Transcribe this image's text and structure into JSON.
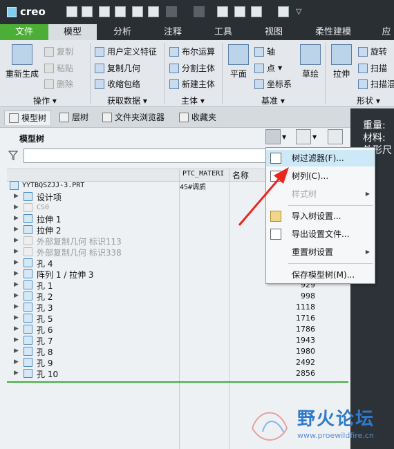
{
  "app": {
    "logo_text": "creo"
  },
  "quick_access": [
    "new-icon",
    "open-icon",
    "save-icon",
    "regenerate-icon",
    "print-icon",
    "copy-icon",
    "undo-icon",
    "redo-icon",
    "regen-icon",
    "sketch-icon",
    "windows-icon",
    "close-icon",
    "more-icon"
  ],
  "ribbon_tabs": [
    {
      "label": "文件"
    },
    {
      "label": "模型"
    },
    {
      "label": "分析"
    },
    {
      "label": "注释"
    },
    {
      "label": "工具"
    },
    {
      "label": "视图"
    },
    {
      "label": "柔性建模"
    },
    {
      "label": "应"
    }
  ],
  "ribbon": {
    "regen": "重新生成",
    "copy": "复制",
    "paste": "粘贴",
    "delete": "删除",
    "udf": "用户定义特征",
    "copy_geom": "复制几何",
    "shrinkwrap": "收缩包络",
    "boolean": "布尔运算",
    "split_body": "分割主体",
    "new_body": "新建主体",
    "plane": "平面",
    "axis": "轴",
    "point": "点",
    "csys": "坐标系",
    "sketch": "草绘",
    "extrude": "拉伸",
    "revolve": "旋转",
    "sweep": "扫描",
    "swept_blend": "扫描混",
    "groups": {
      "operations": "操作",
      "get_data": "获取数据",
      "body": "主体",
      "datum": "基准",
      "shapes": "形状"
    }
  },
  "nav_tabs": [
    {
      "label": "模型树"
    },
    {
      "label": "层树"
    },
    {
      "label": "文件夹浏览器"
    },
    {
      "label": "收藏夹"
    }
  ],
  "tree": {
    "title": "模型树",
    "filter_placeholder": "",
    "columns": [
      "PTC_MATERI",
      "名称"
    ],
    "rows": [
      {
        "label": "YYTBQSZJJ-3.PRT",
        "value": "45#调质",
        "num": ""
      },
      {
        "label": "设计项",
        "value": "",
        "num": ""
      },
      {
        "label": "CS0",
        "value": "",
        "num": ""
      },
      {
        "label": "拉伸 1",
        "value": "",
        "num": ""
      },
      {
        "label": "拉伸 2",
        "value": "",
        "num": ""
      },
      {
        "label": "外部复制几何 标识113",
        "value": "",
        "num": ""
      },
      {
        "label": "外部复制几何 标识338",
        "value": "",
        "num": ""
      },
      {
        "label": "孔 4",
        "value": "",
        "num": ""
      },
      {
        "label": "阵列 1 / 拉伸 3",
        "value": "",
        "num": ""
      },
      {
        "label": "孔 1",
        "value": "",
        "num": "929"
      },
      {
        "label": "孔 2",
        "value": "",
        "num": "998"
      },
      {
        "label": "孔 3",
        "value": "",
        "num": "1118"
      },
      {
        "label": "孔 5",
        "value": "",
        "num": "1716"
      },
      {
        "label": "孔 6",
        "value": "",
        "num": "1786"
      },
      {
        "label": "孔 7",
        "value": "",
        "num": "1943"
      },
      {
        "label": "孔 8",
        "value": "",
        "num": "1980"
      },
      {
        "label": "孔 9",
        "value": "",
        "num": "2492"
      },
      {
        "label": "孔 10",
        "value": "",
        "num": "2856"
      }
    ]
  },
  "graphics_text": [
    "重量:",
    "材料:",
    "外形尺"
  ],
  "menu": {
    "items": [
      {
        "label": "树过滤器(F)...",
        "icon": "tree-filter-icon",
        "submenu": false,
        "disabled": false
      },
      {
        "label": "树列(C)...",
        "icon": "tree-columns-icon",
        "submenu": false,
        "disabled": false
      },
      {
        "label": "样式树",
        "icon": "",
        "submenu": true,
        "disabled": true
      },
      {
        "label": "导入树设置...",
        "icon": "open-folder-icon",
        "submenu": false,
        "disabled": false
      },
      {
        "label": "导出设置文件...",
        "icon": "save-icon",
        "submenu": false,
        "disabled": false
      },
      {
        "label": "重置树设置",
        "icon": "",
        "submenu": true,
        "disabled": false
      },
      {
        "label": "保存模型树(M)...",
        "icon": "",
        "submenu": false,
        "disabled": false
      }
    ]
  },
  "watermark": {
    "text": "野火论坛",
    "url": "www.proewildfire.cn"
  },
  "colors": {
    "accent_green": "#4cae36",
    "dark_bg": "#2a2f34",
    "highlight": "#cde8f7",
    "arrow_red": "#e8261e"
  }
}
